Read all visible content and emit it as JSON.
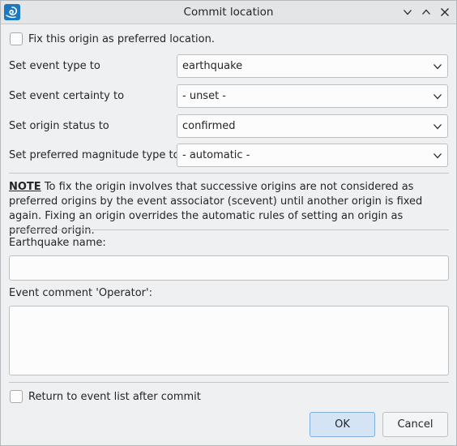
{
  "window": {
    "title": "Commit location",
    "controls": [
      "minimize",
      "maximize",
      "close"
    ]
  },
  "fix_origin": {
    "label": "Fix this origin as preferred location.",
    "checked": false
  },
  "fields": [
    {
      "label": "Set event type to",
      "value": "earthquake"
    },
    {
      "label": "Set event certainty to",
      "value": "- unset -"
    },
    {
      "label": "Set origin status to",
      "value": "confirmed"
    },
    {
      "label": "Set preferred magnitude type to",
      "value": "- automatic -"
    }
  ],
  "note": {
    "keyword": "NOTE",
    "text": " To fix the origin involves that successive origins are not considered as preferred origins by the event associator (scevent) until another origin is fixed again. Fixing an origin overrides the automatic rules of setting an origin as preferred origin."
  },
  "earthquake_name": {
    "label": "Earthquake name:",
    "value": ""
  },
  "event_comment": {
    "label": "Event comment 'Operator':",
    "value": ""
  },
  "return_to_list": {
    "label": "Return to event list after commit",
    "checked": false
  },
  "buttons": {
    "ok": "OK",
    "cancel": "Cancel"
  },
  "colors": {
    "accent": "#3daee9",
    "ok_bg": "#d4e4f4",
    "app_icon": "#1c78c0"
  },
  "icons": {
    "app": "seiscomp-logo-icon",
    "minimize": "chevron-down-icon",
    "maximize": "chevron-up-icon",
    "close": "close-icon",
    "dropdown": "chevron-down-icon"
  }
}
